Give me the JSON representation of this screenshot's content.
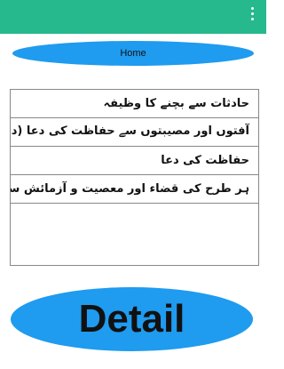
{
  "home_button": {
    "label": "Home"
  },
  "list": {
    "items": [
      {
        "label": "حادثات سے بچنے کا وظیفہ"
      },
      {
        "label": "آفتوں اور مصیبتوں سے حفاظت کی دعا (دعائے انس ﷺ)"
      },
      {
        "label": "حفاظت کی دعا"
      },
      {
        "label": "ہر طرح کی قضاء اور معصیت و آزمائش سے حفاظت کی دعا"
      }
    ]
  },
  "detail_button": {
    "label": "Detail"
  },
  "colors": {
    "app_bar": "#27b98e",
    "button_blue": "#1f9bef",
    "divider": "#888888"
  },
  "icons": {
    "overflow_menu": "more-vert-icon"
  }
}
